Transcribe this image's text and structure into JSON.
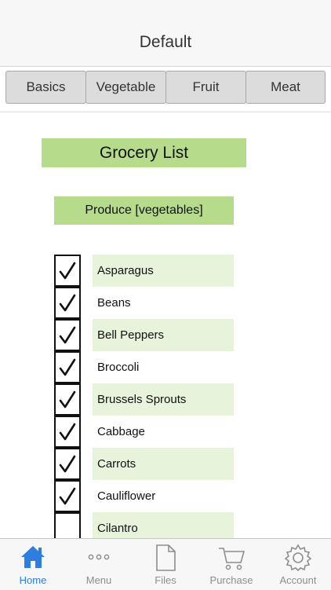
{
  "header": {
    "title": "Default"
  },
  "segments": [
    "Basics",
    "Vegetable",
    "Fruit",
    "Meat"
  ],
  "list_title": "Grocery List",
  "section_title": "Produce [vegetables]",
  "items": [
    {
      "label": "Asparagus",
      "checked": true
    },
    {
      "label": "Beans",
      "checked": true
    },
    {
      "label": "Bell Peppers",
      "checked": true
    },
    {
      "label": "Broccoli",
      "checked": true
    },
    {
      "label": "Brussels Sprouts",
      "checked": true
    },
    {
      "label": "Cabbage",
      "checked": true
    },
    {
      "label": "Carrots",
      "checked": true
    },
    {
      "label": "Cauliflower",
      "checked": true
    },
    {
      "label": "Cilantro",
      "checked": false
    }
  ],
  "tabs": [
    {
      "label": "Home",
      "icon": "home-icon",
      "active": true
    },
    {
      "label": "Menu",
      "icon": "more-dots-icon",
      "active": false
    },
    {
      "label": "Files",
      "icon": "file-icon",
      "active": false
    },
    {
      "label": "Purchase",
      "icon": "cart-icon",
      "active": false
    },
    {
      "label": "Account",
      "icon": "gear-icon",
      "active": false
    }
  ],
  "colors": {
    "accent": "#2f7de1",
    "green_header": "#b6dc8b",
    "green_row": "#e8f3dc",
    "inactive_tab": "#8e8e8e"
  }
}
